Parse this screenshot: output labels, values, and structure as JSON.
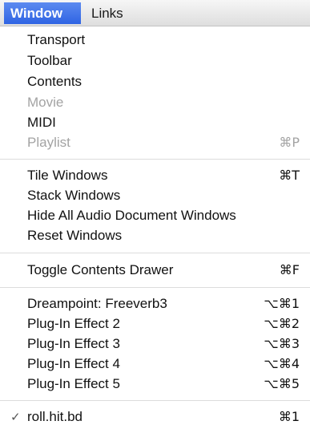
{
  "menubar": {
    "window_label": "Window",
    "links_label": "Links"
  },
  "menu": {
    "group1": [
      {
        "label": "Transport",
        "shortcut": "",
        "enabled": true
      },
      {
        "label": "Toolbar",
        "shortcut": "",
        "enabled": true
      },
      {
        "label": "Contents",
        "shortcut": "",
        "enabled": true
      },
      {
        "label": "Movie",
        "shortcut": "",
        "enabled": false
      },
      {
        "label": "MIDI",
        "shortcut": "",
        "enabled": true
      },
      {
        "label": "Playlist",
        "shortcut": "⌘P",
        "enabled": false
      }
    ],
    "group2": [
      {
        "label": "Tile Windows",
        "shortcut": "⌘T",
        "enabled": true
      },
      {
        "label": "Stack Windows",
        "shortcut": "",
        "enabled": true
      },
      {
        "label": "Hide All Audio Document Windows",
        "shortcut": "",
        "enabled": true
      },
      {
        "label": "Reset Windows",
        "shortcut": "",
        "enabled": true
      }
    ],
    "group3": [
      {
        "label": "Toggle Contents Drawer",
        "shortcut": "⌘F",
        "enabled": true
      }
    ],
    "group4": [
      {
        "label": "Dreampoint: Freeverb3",
        "shortcut": "⌥⌘1",
        "enabled": true
      },
      {
        "label": "Plug-In Effect 2",
        "shortcut": "⌥⌘2",
        "enabled": true
      },
      {
        "label": "Plug-In Effect 3",
        "shortcut": "⌥⌘3",
        "enabled": true
      },
      {
        "label": "Plug-In Effect 4",
        "shortcut": "⌥⌘4",
        "enabled": true
      },
      {
        "label": "Plug-In Effect 5",
        "shortcut": "⌥⌘5",
        "enabled": true
      }
    ],
    "group5": [
      {
        "label": "roll.hit.bd",
        "shortcut": "⌘1",
        "enabled": true,
        "checked": true,
        "check_glyph": "✓"
      }
    ]
  }
}
